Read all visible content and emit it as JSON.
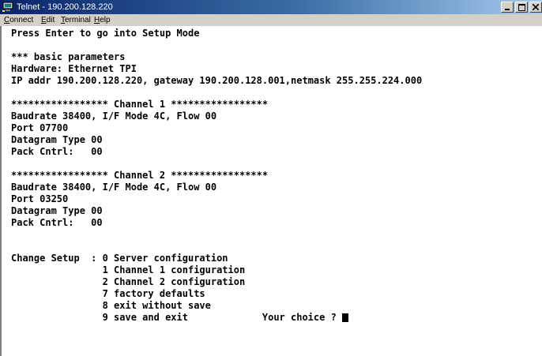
{
  "window": {
    "title": "Telnet - 190.200.128.220",
    "icon": "telnet-terminal-icon",
    "controls": [
      "minimize-icon",
      "maximize-icon",
      "close-icon"
    ]
  },
  "menu": [
    {
      "pre": "",
      "accel": "C",
      "rest": "onnect"
    },
    {
      "pre": "",
      "accel": "E",
      "rest": "dit"
    },
    {
      "pre": "",
      "accel": "T",
      "rest": "erminal"
    },
    {
      "pre": "",
      "accel": "H",
      "rest": "elp"
    }
  ],
  "terminal": {
    "lines": [
      "Press Enter to go into Setup Mode",
      "",
      "*** basic parameters",
      "Hardware: Ethernet TPI",
      "IP addr 190.200.128.220, gateway 190.200.128.001,netmask 255.255.224.000",
      "",
      "***************** Channel 1 *****************",
      "Baudrate 38400, I/F Mode 4C, Flow 00",
      "Port 07700",
      "Datagram Type 00",
      "Pack Cntrl:   00",
      "",
      "***************** Channel 2 *****************",
      "Baudrate 38400, I/F Mode 4C, Flow 00",
      "Port 03250",
      "Datagram Type 00",
      "Pack Cntrl:   00",
      "",
      "",
      "Change Setup  : 0 Server configuration",
      "                1 Channel 1 configuration",
      "                2 Channel 2 configuration",
      "                7 factory defaults",
      "                8 exit without save",
      "                9 save and exit             Your choice ? "
    ]
  }
}
